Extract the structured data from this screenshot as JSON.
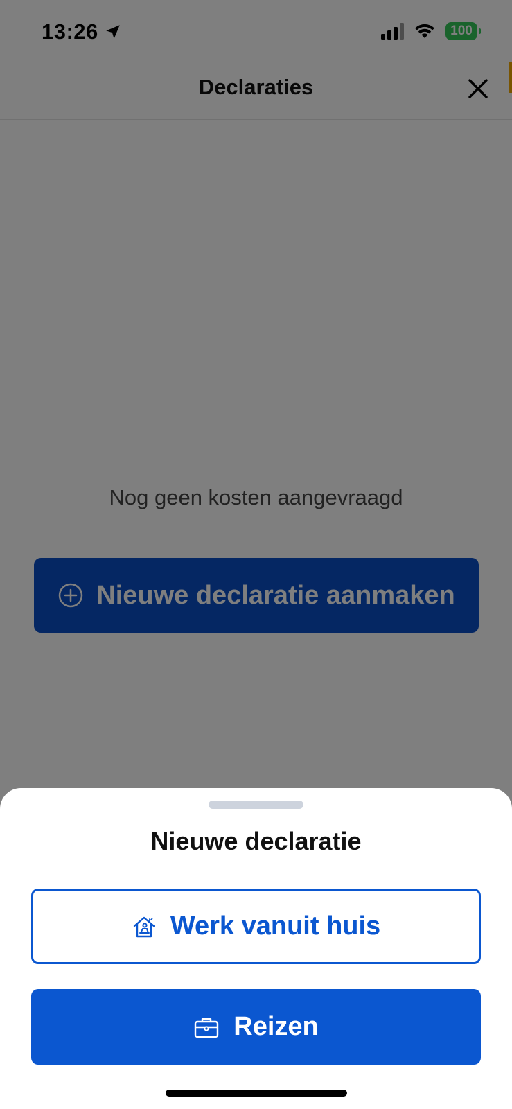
{
  "status_bar": {
    "time": "13:26",
    "battery": "100"
  },
  "header": {
    "title": "Declaraties"
  },
  "main": {
    "empty_text": "Nog geen kosten aangevraagd",
    "new_button_label": "Nieuwe declaratie aanmaken"
  },
  "sheet": {
    "title": "Nieuwe declaratie",
    "options": [
      {
        "label": "Werk vanuit huis"
      },
      {
        "label": "Reizen"
      }
    ]
  },
  "colors": {
    "primary": "#0b57d0",
    "battery": "#34c759",
    "accent": "#f2a900"
  },
  "icons": {
    "location": "location-arrow-icon",
    "close": "close-icon",
    "add": "plus-circle-icon",
    "home": "home-work-icon",
    "travel": "briefcase-icon"
  }
}
